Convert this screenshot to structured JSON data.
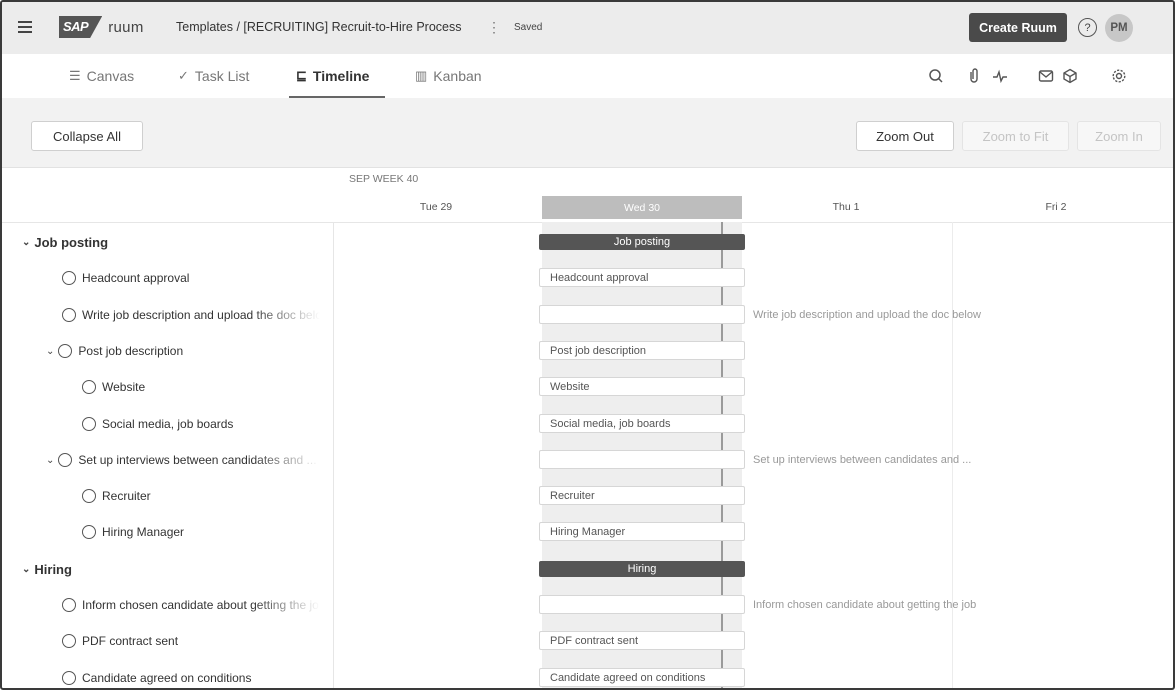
{
  "header": {
    "brand": "SAP",
    "app": "ruum",
    "breadcrumb": "Templates / [RECRUITING] Recruit-to-Hire Process",
    "kebab": "⋮",
    "status": "Saved",
    "create_label": "Create Ruum",
    "help": "?",
    "avatar": "PM"
  },
  "tabs": [
    {
      "label": "Canvas",
      "icon": "canvas-icon",
      "glyph": "☰"
    },
    {
      "label": "Task List",
      "icon": "task-list-icon",
      "glyph": "✓"
    },
    {
      "label": "Timeline",
      "icon": "timeline-icon",
      "glyph": "⊑"
    },
    {
      "label": "Kanban",
      "icon": "kanban-icon",
      "glyph": "▥"
    }
  ],
  "toolbar_icons": [
    "search-user-icon",
    "attachment-icon",
    "activity-icon",
    "mail-icon",
    "box-icon",
    "settings-icon"
  ],
  "toolbar": {
    "collapse_all": "Collapse All",
    "zoom_out": "Zoom Out",
    "zoom_to_fit": "Zoom to Fit",
    "zoom_in": "Zoom In"
  },
  "timeline": {
    "week": "SEP WEEK 40",
    "days": [
      "Tue 29",
      "Wed 30",
      "Thu 1",
      "Fri 2"
    ]
  },
  "rows": [
    {
      "label": "Job posting",
      "type": "section",
      "bar": "Job posting"
    },
    {
      "label": "Headcount approval",
      "type": "task",
      "bar": "Headcount approval"
    },
    {
      "label": "Write job description and upload the doc below",
      "type": "task",
      "bar": "",
      "ext": "Write job description and upload the doc below"
    },
    {
      "label": "Post job description",
      "type": "group",
      "bar": "Post job description"
    },
    {
      "label": "Website",
      "type": "subtask",
      "bar": "Website"
    },
    {
      "label": "Social media, job boards",
      "type": "subtask",
      "bar": "Social media, job boards"
    },
    {
      "label": "Set up interviews between candidates and ...",
      "type": "group",
      "bar": "",
      "ext": "Set up interviews between candidates and ..."
    },
    {
      "label": "Recruiter",
      "type": "subtask",
      "bar": "Recruiter"
    },
    {
      "label": "Hiring Manager",
      "type": "subtask",
      "bar": "Hiring Manager"
    },
    {
      "label": "Hiring",
      "type": "section",
      "bar": "Hiring"
    },
    {
      "label": "Inform chosen candidate about getting the job",
      "type": "task",
      "bar": "",
      "ext": "Inform chosen candidate about getting the job"
    },
    {
      "label": "PDF contract sent",
      "type": "task",
      "bar": "PDF contract sent"
    },
    {
      "label": "Candidate agreed on conditions",
      "type": "task",
      "bar": "Candidate agreed on conditions"
    }
  ]
}
